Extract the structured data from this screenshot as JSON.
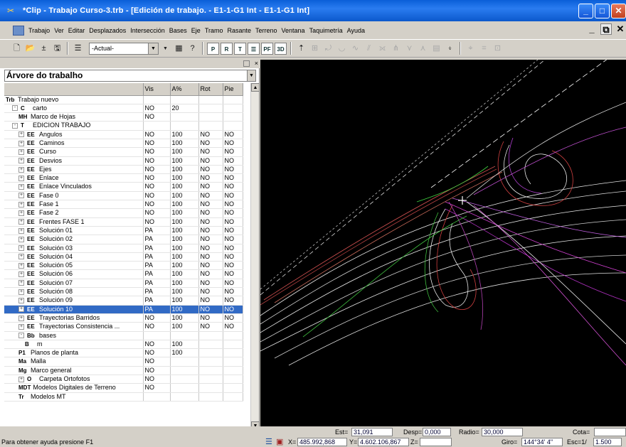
{
  "window": {
    "title": "*Clip - Trabajo Curso-3.trb - [Edición de trabajo. - E1-1-G1 Int - E1-1-G1 Int]",
    "buttons": [
      "_",
      "□",
      "✕"
    ]
  },
  "menu": [
    "Trabajo",
    "Ver",
    "Editar",
    "Desplazados",
    "Intersección",
    "Bases",
    "Eje",
    "Tramo",
    "Rasante",
    "Terreno",
    "Ventana",
    "Taquimetría",
    "Ayuda"
  ],
  "toolbar": {
    "layer_select_value": "-Actual-",
    "text_buttons": [
      "P",
      "R",
      "T",
      "PF",
      "3D"
    ]
  },
  "tree": {
    "selector": "Árvore do trabalho",
    "columns": [
      "",
      "Vis",
      "A%",
      "Rot",
      "Pie"
    ],
    "rows": [
      {
        "icon": "Trb",
        "label": "Trabajo nuevo",
        "vis": "",
        "a": "",
        "rot": "",
        "pie": "",
        "indent": 0,
        "expander": ""
      },
      {
        "icon": "C",
        "label": "carto",
        "vis": "NO",
        "a": "20",
        "rot": "",
        "pie": "",
        "indent": 1,
        "expander": "-"
      },
      {
        "icon": "MH",
        "label": "Marco de Hojas",
        "vis": "NO",
        "a": "",
        "rot": "",
        "pie": "",
        "indent": 2,
        "expander": ""
      },
      {
        "icon": "T",
        "label": "EDICION TRABAJO",
        "vis": "",
        "a": "",
        "rot": "",
        "pie": "",
        "indent": 1,
        "expander": "-"
      },
      {
        "icon": "EE",
        "label": "Angulos",
        "vis": "NO",
        "a": "100",
        "rot": "NO",
        "pie": "NO",
        "indent": 2,
        "expander": "+"
      },
      {
        "icon": "EE",
        "label": "Caminos",
        "vis": "NO",
        "a": "100",
        "rot": "NO",
        "pie": "NO",
        "indent": 2,
        "expander": "+"
      },
      {
        "icon": "EE",
        "label": "Curso",
        "vis": "NO",
        "a": "100",
        "rot": "NO",
        "pie": "NO",
        "indent": 2,
        "expander": "+"
      },
      {
        "icon": "EE",
        "label": "Desvios",
        "vis": "NO",
        "a": "100",
        "rot": "NO",
        "pie": "NO",
        "indent": 2,
        "expander": "+"
      },
      {
        "icon": "EE",
        "label": "Ejes",
        "vis": "NO",
        "a": "100",
        "rot": "NO",
        "pie": "NO",
        "indent": 2,
        "expander": "+"
      },
      {
        "icon": "EE",
        "label": "Enlace",
        "vis": "NO",
        "a": "100",
        "rot": "NO",
        "pie": "NO",
        "indent": 2,
        "expander": "+"
      },
      {
        "icon": "EE",
        "label": "Enlace Vinculados",
        "vis": "NO",
        "a": "100",
        "rot": "NO",
        "pie": "NO",
        "indent": 2,
        "expander": "+"
      },
      {
        "icon": "EE",
        "label": "Fase 0",
        "vis": "NO",
        "a": "100",
        "rot": "NO",
        "pie": "NO",
        "indent": 2,
        "expander": "+"
      },
      {
        "icon": "EE",
        "label": "Fase 1",
        "vis": "NO",
        "a": "100",
        "rot": "NO",
        "pie": "NO",
        "indent": 2,
        "expander": "+"
      },
      {
        "icon": "EE",
        "label": "Fase 2",
        "vis": "NO",
        "a": "100",
        "rot": "NO",
        "pie": "NO",
        "indent": 2,
        "expander": "+"
      },
      {
        "icon": "EE",
        "label": "Frentes FASE 1",
        "vis": "NO",
        "a": "100",
        "rot": "NO",
        "pie": "NO",
        "indent": 2,
        "expander": "+"
      },
      {
        "icon": "EE",
        "label": "Solución 01",
        "vis": "PA",
        "a": "100",
        "rot": "NO",
        "pie": "NO",
        "indent": 2,
        "expander": "+"
      },
      {
        "icon": "EE",
        "label": "Solución 02",
        "vis": "PA",
        "a": "100",
        "rot": "NO",
        "pie": "NO",
        "indent": 2,
        "expander": "+"
      },
      {
        "icon": "EE",
        "label": "Solución 03",
        "vis": "PA",
        "a": "100",
        "rot": "NO",
        "pie": "NO",
        "indent": 2,
        "expander": "+"
      },
      {
        "icon": "EE",
        "label": "Solución 04",
        "vis": "PA",
        "a": "100",
        "rot": "NO",
        "pie": "NO",
        "indent": 2,
        "expander": "+"
      },
      {
        "icon": "EE",
        "label": "Solución 05",
        "vis": "PA",
        "a": "100",
        "rot": "NO",
        "pie": "NO",
        "indent": 2,
        "expander": "+"
      },
      {
        "icon": "EE",
        "label": "Solución 06",
        "vis": "PA",
        "a": "100",
        "rot": "NO",
        "pie": "NO",
        "indent": 2,
        "expander": "+"
      },
      {
        "icon": "EE",
        "label": "Solución 07",
        "vis": "PA",
        "a": "100",
        "rot": "NO",
        "pie": "NO",
        "indent": 2,
        "expander": "+"
      },
      {
        "icon": "EE",
        "label": "Solución 08",
        "vis": "PA",
        "a": "100",
        "rot": "NO",
        "pie": "NO",
        "indent": 2,
        "expander": "+"
      },
      {
        "icon": "EE",
        "label": "Solución 09",
        "vis": "PA",
        "a": "100",
        "rot": "NO",
        "pie": "NO",
        "indent": 2,
        "expander": "+"
      },
      {
        "icon": "EE",
        "label": "Solución 10",
        "vis": "PA",
        "a": "100",
        "rot": "NO",
        "pie": "NO",
        "indent": 2,
        "expander": "+",
        "selected": true
      },
      {
        "icon": "EE",
        "label": "Trayectorias Barridos",
        "vis": "NO",
        "a": "100",
        "rot": "NO",
        "pie": "NO",
        "indent": 2,
        "expander": "+"
      },
      {
        "icon": "EE",
        "label": "Trayectorias Consistencia ...",
        "vis": "NO",
        "a": "100",
        "rot": "NO",
        "pie": "NO",
        "indent": 2,
        "expander": "+"
      },
      {
        "icon": "Bb",
        "label": "bases",
        "vis": "",
        "a": "",
        "rot": "",
        "pie": "",
        "indent": 2,
        "expander": "-"
      },
      {
        "icon": "B",
        "label": "m",
        "vis": "NO",
        "a": "100",
        "rot": "",
        "pie": "",
        "indent": 3,
        "expander": ""
      },
      {
        "icon": "P1",
        "label": "Planos de planta",
        "vis": "NO",
        "a": "100",
        "rot": "",
        "pie": "",
        "indent": 2,
        "expander": ""
      },
      {
        "icon": "Ma",
        "label": "Malla",
        "vis": "NO",
        "a": "",
        "rot": "",
        "pie": "",
        "indent": 2,
        "expander": ""
      },
      {
        "icon": "Mg",
        "label": "Marco general",
        "vis": "NO",
        "a": "",
        "rot": "",
        "pie": "",
        "indent": 2,
        "expander": ""
      },
      {
        "icon": "O",
        "label": "Carpeta Ortofotos",
        "vis": "NO",
        "a": "",
        "rot": "",
        "pie": "",
        "indent": 2,
        "expander": "+"
      },
      {
        "icon": "MDT",
        "label": "Modelos Digitales de Terreno",
        "vis": "NO",
        "a": "",
        "rot": "",
        "pie": "",
        "indent": 2,
        "expander": ""
      },
      {
        "icon": "Tr",
        "label": "Modelos MT",
        "vis": "",
        "a": "",
        "rot": "",
        "pie": "",
        "indent": 2,
        "expander": ""
      }
    ]
  },
  "status": {
    "help": "Para obtener ayuda presione F1",
    "est_label": "Est=",
    "est": "31,091",
    "desp_label": "Desp=",
    "desp": "0,000",
    "radio_label": "Radio=",
    "radio": "30,000",
    "cota_label": "Cota=",
    "cota": "",
    "x_label": "X=",
    "x": "485.992,868",
    "y_label": "Y=",
    "y": "4.602.106,867",
    "z_label": "Z=",
    "z": "",
    "giro_label": "Giro=",
    "giro": "144°34' 4\"",
    "esc_label": "Esc=1/",
    "esc": "1.500"
  },
  "colors": {
    "title_blue": "#0a5fd8",
    "selection": "#316ac5",
    "canvas_bg": "#000000"
  }
}
